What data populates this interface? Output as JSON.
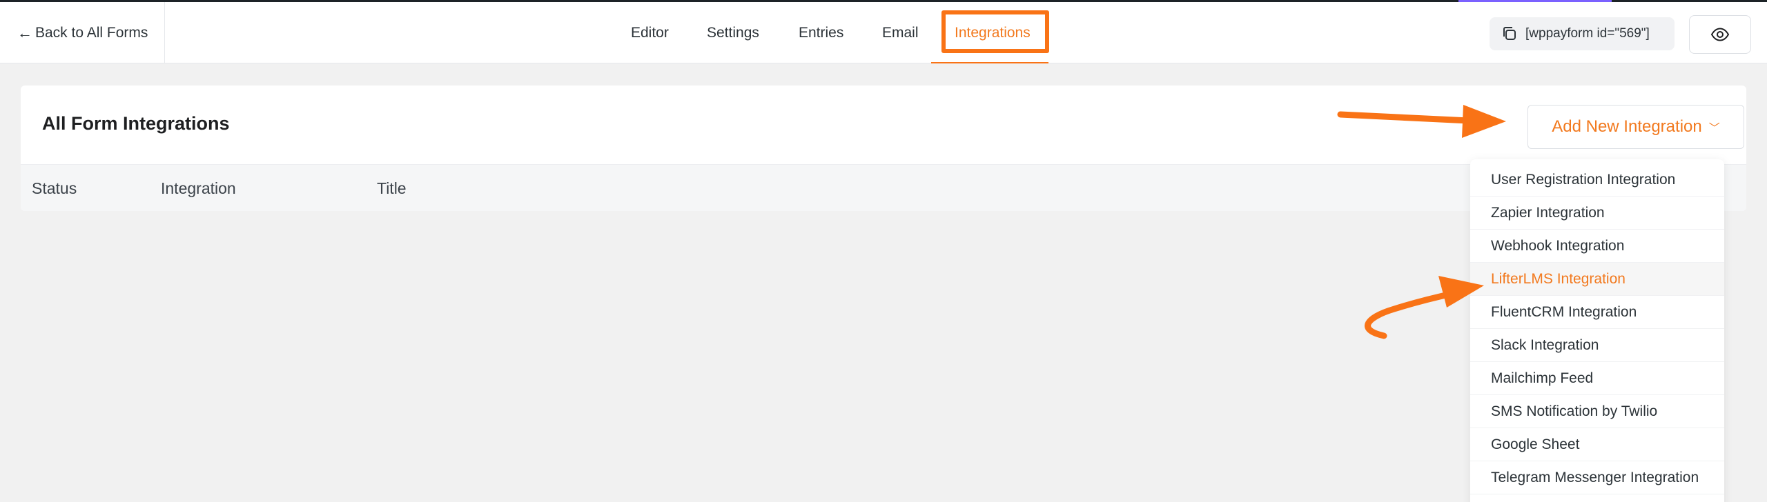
{
  "header": {
    "back_label": "Back to All Forms",
    "nav": [
      "Editor",
      "Settings",
      "Entries",
      "Email",
      "Integrations"
    ],
    "active_nav": "Integrations",
    "shortcode": "[wppayform id=\"569\"]"
  },
  "card": {
    "title": "All Form Integrations",
    "add_button": "Add New Integration",
    "columns": [
      "Status",
      "Integration",
      "Title"
    ]
  },
  "dropdown": {
    "items": [
      "User Registration Integration",
      "Zapier Integration",
      "Webhook Integration",
      "LifterLMS Integration",
      "FluentCRM Integration",
      "Slack Integration",
      "Mailchimp Feed",
      "SMS Notification by Twilio",
      "Google Sheet",
      "Telegram Messenger Integration"
    ],
    "highlighted": "LifterLMS Integration"
  },
  "icons": {
    "back": "arrow-left-icon",
    "copy": "copy-icon",
    "preview": "eye-icon",
    "chevron": "chevron-down-icon"
  },
  "colors": {
    "accent": "#f2791e",
    "annotation": "#f97316"
  }
}
